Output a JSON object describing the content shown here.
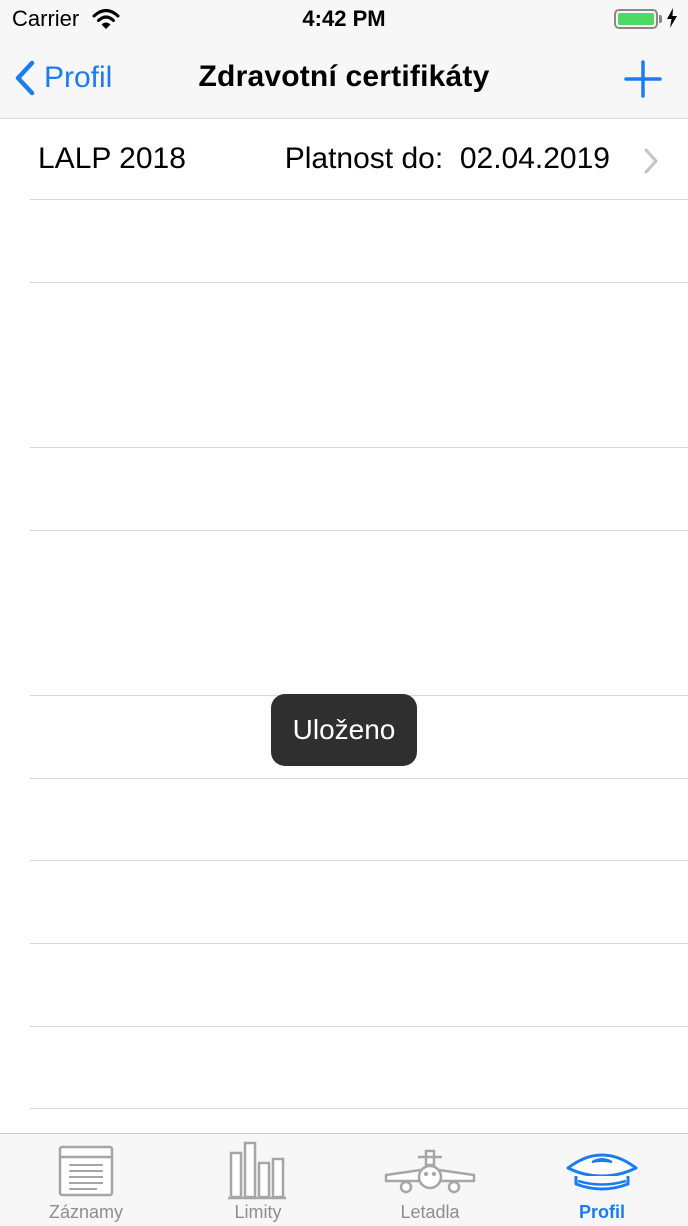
{
  "status_bar": {
    "carrier": "Carrier",
    "time": "4:42 PM"
  },
  "nav": {
    "back_label": "Profil",
    "title": "Zdravotní certifikáty",
    "add_icon": "plus-icon"
  },
  "certificates": [
    {
      "name": "LALP 2018",
      "validity_label": "Platnost do:",
      "validity_date": "02.04.2019"
    }
  ],
  "toast": {
    "text": "Uloženo"
  },
  "tab_bar": {
    "active_color": "#1b7cf2",
    "inactive_color": "#8e8e8e",
    "items": [
      {
        "label": "Záznamy",
        "icon": "logbook-icon",
        "active": false
      },
      {
        "label": "Limity",
        "icon": "bar-chart-icon",
        "active": false
      },
      {
        "label": "Letadla",
        "icon": "airplane-icon",
        "active": false
      },
      {
        "label": "Profil",
        "icon": "pilot-cap-icon",
        "active": true
      }
    ]
  }
}
